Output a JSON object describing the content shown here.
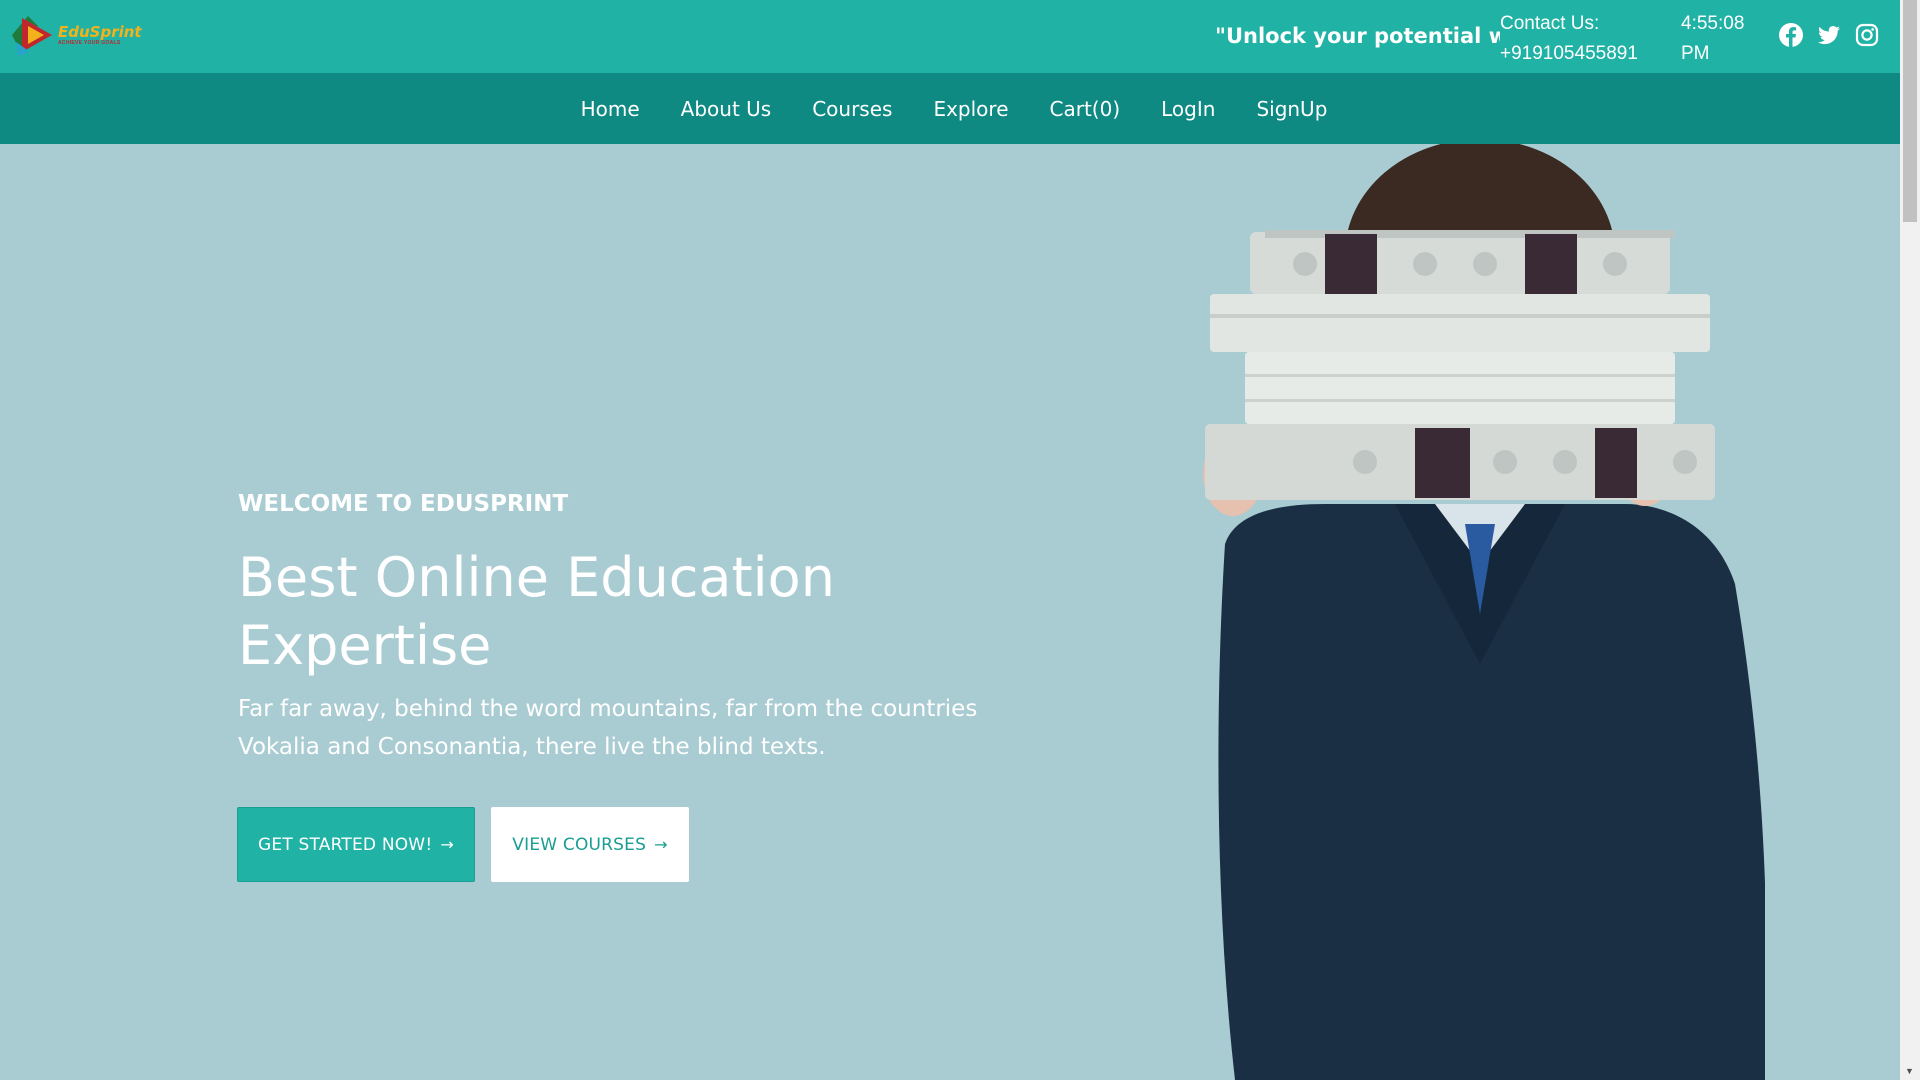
{
  "header": {
    "logo": {
      "name": "EduSprint",
      "tagline": "ACHIEVE YOUR GOALS"
    },
    "marquee_text": "\"Unlock your potential wit",
    "contact": {
      "label": "Contact Us:",
      "phone": "+919105455891"
    },
    "clock": {
      "time": "4:55:08",
      "ampm": "PM"
    },
    "social": [
      "facebook-icon",
      "twitter-icon",
      "instagram-icon"
    ]
  },
  "nav": {
    "items": [
      "Home",
      "About Us",
      "Courses",
      "Explore",
      "Cart(0)",
      "LogIn",
      "SignUp"
    ]
  },
  "hero": {
    "eyebrow": "WELCOME TO EDUSPRINT",
    "title_line1": "Best Online Education",
    "title_line2": "Expertise",
    "description": "Far far away, behind the word mountains, far from the countries Vokalia and Consonantia, there live the blind texts.",
    "primary_button": "GET STARTED NOW!",
    "secondary_button": "VIEW COURSES",
    "arrow": "→"
  },
  "colors": {
    "topbar": "#20b2a5",
    "navbar": "#0e8a83",
    "hero_bg": "#a9cbd2",
    "accent": "#20b2a5"
  }
}
